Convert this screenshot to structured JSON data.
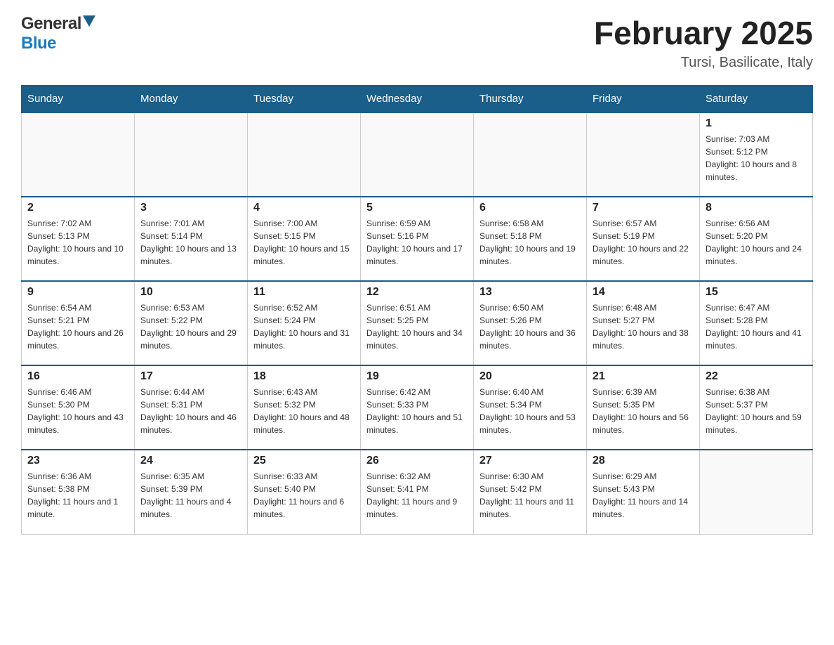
{
  "header": {
    "logo_general": "General",
    "logo_blue": "Blue",
    "title": "February 2025",
    "subtitle": "Tursi, Basilicate, Italy"
  },
  "weekdays": [
    "Sunday",
    "Monday",
    "Tuesday",
    "Wednesday",
    "Thursday",
    "Friday",
    "Saturday"
  ],
  "weeks": [
    [
      {
        "day": "",
        "info": ""
      },
      {
        "day": "",
        "info": ""
      },
      {
        "day": "",
        "info": ""
      },
      {
        "day": "",
        "info": ""
      },
      {
        "day": "",
        "info": ""
      },
      {
        "day": "",
        "info": ""
      },
      {
        "day": "1",
        "info": "Sunrise: 7:03 AM\nSunset: 5:12 PM\nDaylight: 10 hours and 8 minutes."
      }
    ],
    [
      {
        "day": "2",
        "info": "Sunrise: 7:02 AM\nSunset: 5:13 PM\nDaylight: 10 hours and 10 minutes."
      },
      {
        "day": "3",
        "info": "Sunrise: 7:01 AM\nSunset: 5:14 PM\nDaylight: 10 hours and 13 minutes."
      },
      {
        "day": "4",
        "info": "Sunrise: 7:00 AM\nSunset: 5:15 PM\nDaylight: 10 hours and 15 minutes."
      },
      {
        "day": "5",
        "info": "Sunrise: 6:59 AM\nSunset: 5:16 PM\nDaylight: 10 hours and 17 minutes."
      },
      {
        "day": "6",
        "info": "Sunrise: 6:58 AM\nSunset: 5:18 PM\nDaylight: 10 hours and 19 minutes."
      },
      {
        "day": "7",
        "info": "Sunrise: 6:57 AM\nSunset: 5:19 PM\nDaylight: 10 hours and 22 minutes."
      },
      {
        "day": "8",
        "info": "Sunrise: 6:56 AM\nSunset: 5:20 PM\nDaylight: 10 hours and 24 minutes."
      }
    ],
    [
      {
        "day": "9",
        "info": "Sunrise: 6:54 AM\nSunset: 5:21 PM\nDaylight: 10 hours and 26 minutes."
      },
      {
        "day": "10",
        "info": "Sunrise: 6:53 AM\nSunset: 5:22 PM\nDaylight: 10 hours and 29 minutes."
      },
      {
        "day": "11",
        "info": "Sunrise: 6:52 AM\nSunset: 5:24 PM\nDaylight: 10 hours and 31 minutes."
      },
      {
        "day": "12",
        "info": "Sunrise: 6:51 AM\nSunset: 5:25 PM\nDaylight: 10 hours and 34 minutes."
      },
      {
        "day": "13",
        "info": "Sunrise: 6:50 AM\nSunset: 5:26 PM\nDaylight: 10 hours and 36 minutes."
      },
      {
        "day": "14",
        "info": "Sunrise: 6:48 AM\nSunset: 5:27 PM\nDaylight: 10 hours and 38 minutes."
      },
      {
        "day": "15",
        "info": "Sunrise: 6:47 AM\nSunset: 5:28 PM\nDaylight: 10 hours and 41 minutes."
      }
    ],
    [
      {
        "day": "16",
        "info": "Sunrise: 6:46 AM\nSunset: 5:30 PM\nDaylight: 10 hours and 43 minutes."
      },
      {
        "day": "17",
        "info": "Sunrise: 6:44 AM\nSunset: 5:31 PM\nDaylight: 10 hours and 46 minutes."
      },
      {
        "day": "18",
        "info": "Sunrise: 6:43 AM\nSunset: 5:32 PM\nDaylight: 10 hours and 48 minutes."
      },
      {
        "day": "19",
        "info": "Sunrise: 6:42 AM\nSunset: 5:33 PM\nDaylight: 10 hours and 51 minutes."
      },
      {
        "day": "20",
        "info": "Sunrise: 6:40 AM\nSunset: 5:34 PM\nDaylight: 10 hours and 53 minutes."
      },
      {
        "day": "21",
        "info": "Sunrise: 6:39 AM\nSunset: 5:35 PM\nDaylight: 10 hours and 56 minutes."
      },
      {
        "day": "22",
        "info": "Sunrise: 6:38 AM\nSunset: 5:37 PM\nDaylight: 10 hours and 59 minutes."
      }
    ],
    [
      {
        "day": "23",
        "info": "Sunrise: 6:36 AM\nSunset: 5:38 PM\nDaylight: 11 hours and 1 minute."
      },
      {
        "day": "24",
        "info": "Sunrise: 6:35 AM\nSunset: 5:39 PM\nDaylight: 11 hours and 4 minutes."
      },
      {
        "day": "25",
        "info": "Sunrise: 6:33 AM\nSunset: 5:40 PM\nDaylight: 11 hours and 6 minutes."
      },
      {
        "day": "26",
        "info": "Sunrise: 6:32 AM\nSunset: 5:41 PM\nDaylight: 11 hours and 9 minutes."
      },
      {
        "day": "27",
        "info": "Sunrise: 6:30 AM\nSunset: 5:42 PM\nDaylight: 11 hours and 11 minutes."
      },
      {
        "day": "28",
        "info": "Sunrise: 6:29 AM\nSunset: 5:43 PM\nDaylight: 11 hours and 14 minutes."
      },
      {
        "day": "",
        "info": ""
      }
    ]
  ]
}
